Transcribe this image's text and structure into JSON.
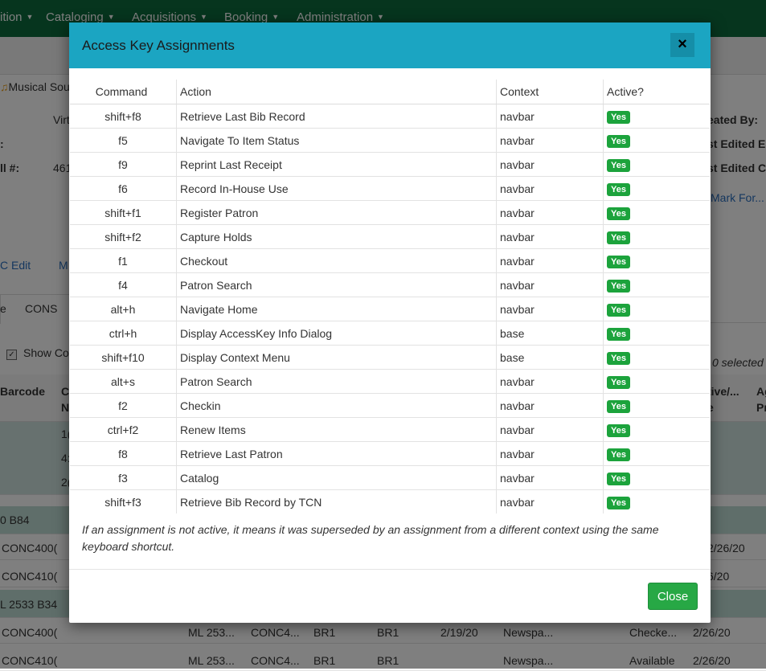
{
  "navbar": {
    "items": [
      {
        "label": "ition"
      },
      {
        "label": "Cataloging"
      },
      {
        "label": "Acquisitions"
      },
      {
        "label": "Booking"
      },
      {
        "label": "Administration"
      }
    ]
  },
  "background": {
    "record_title": "Musical Sou",
    "virt": "Virt",
    "colon_label": ":",
    "call_label": "ll #:",
    "call_value": "461",
    "created_by": "eated By:",
    "last_edited_by": "st Edited E",
    "last_edited_on": "st Edited C",
    "mark_for": "Mark For...",
    "marc_edit": "C Edit",
    "m_link": "M",
    "tab_left": "e",
    "tab_cons": "CONS",
    "show_label": "Show Co",
    "selected_count": "0 selected",
    "col_barcode": "Barcode",
    "col_c": "C",
    "col_n": "N",
    "col_active": "tive/...",
    "col_active2": "e",
    "col_ag": "Ag",
    "col_pr": "Pr",
    "row_vals": [
      "1(",
      "4:",
      "2("
    ],
    "group1": "0 B84",
    "rows_g1": [
      {
        "barcode": "CONC400(",
        "date": "2/26/20"
      },
      {
        "barcode": "CONC410(",
        "date": "6/20"
      }
    ],
    "group2": "L 2533 B34",
    "rows_g2": [
      {
        "barcode": "CONC400(",
        "call": "ML 253...",
        "copy": "CONC4...",
        "lib": "BR1",
        "circ": "BR1",
        "d1": "2/19/20",
        "type": "Newspa...",
        "status": "Checke...",
        "d2": "2/26/20"
      },
      {
        "barcode": "CONC410(",
        "call": "ML 253...",
        "copy": "CONC4...",
        "lib": "BR1",
        "circ": "BR1",
        "d1": "",
        "type": "Newspa...",
        "status": "Available",
        "d2": "2/26/20"
      }
    ]
  },
  "modal": {
    "title": "Access Key Assignments",
    "close_icon": "×",
    "columns": [
      "Command",
      "Action",
      "Context",
      "Active?"
    ],
    "rows": [
      {
        "command": "shift+f8",
        "action": "Retrieve Last Bib Record",
        "context": "navbar",
        "active": "Yes"
      },
      {
        "command": "f5",
        "action": "Navigate To Item Status",
        "context": "navbar",
        "active": "Yes"
      },
      {
        "command": "f9",
        "action": "Reprint Last Receipt",
        "context": "navbar",
        "active": "Yes"
      },
      {
        "command": "f6",
        "action": "Record In-House Use",
        "context": "navbar",
        "active": "Yes"
      },
      {
        "command": "shift+f1",
        "action": "Register Patron",
        "context": "navbar",
        "active": "Yes"
      },
      {
        "command": "shift+f2",
        "action": "Capture Holds",
        "context": "navbar",
        "active": "Yes"
      },
      {
        "command": "f1",
        "action": "Checkout",
        "context": "navbar",
        "active": "Yes"
      },
      {
        "command": "f4",
        "action": "Patron Search",
        "context": "navbar",
        "active": "Yes"
      },
      {
        "command": "alt+h",
        "action": "Navigate Home",
        "context": "navbar",
        "active": "Yes"
      },
      {
        "command": "ctrl+h",
        "action": "Display AccessKey Info Dialog",
        "context": "base",
        "active": "Yes"
      },
      {
        "command": "shift+f10",
        "action": "Display Context Menu",
        "context": "base",
        "active": "Yes"
      },
      {
        "command": "alt+s",
        "action": "Patron Search",
        "context": "navbar",
        "active": "Yes"
      },
      {
        "command": "f2",
        "action": "Checkin",
        "context": "navbar",
        "active": "Yes"
      },
      {
        "command": "ctrl+f2",
        "action": "Renew Items",
        "context": "navbar",
        "active": "Yes"
      },
      {
        "command": "f8",
        "action": "Retrieve Last Patron",
        "context": "navbar",
        "active": "Yes"
      },
      {
        "command": "f3",
        "action": "Catalog",
        "context": "navbar",
        "active": "Yes"
      },
      {
        "command": "shift+f3",
        "action": "Retrieve Bib Record by TCN",
        "context": "navbar",
        "active": "Yes"
      }
    ],
    "note": "If an assignment is not active, it means it was superseded by an assignment from a different context using the same keyboard shortcut.",
    "close_button": "Close"
  },
  "colors": {
    "navbar": "#0d6b3c",
    "modal_header": "#1ba5c2",
    "badge": "#1ca33c",
    "close_button": "#27a845"
  }
}
